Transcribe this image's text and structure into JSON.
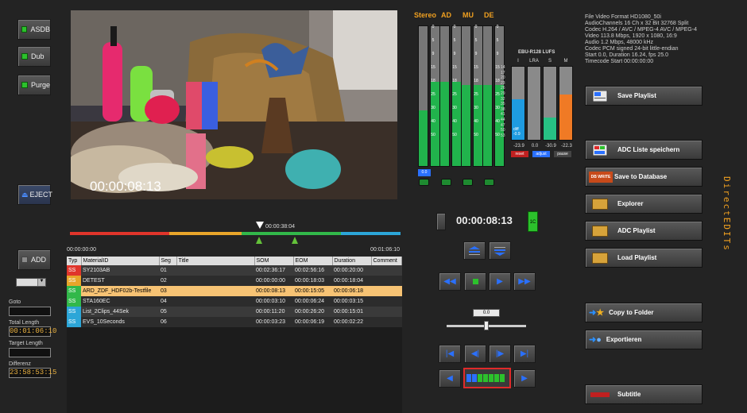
{
  "left_buttons": [
    {
      "label": "ASDB"
    },
    {
      "label": "Dub"
    },
    {
      "label": "Purge"
    }
  ],
  "eject_label": "EJECT",
  "add_label": "ADD",
  "fields": {
    "goto_label": "Goto",
    "total_length_label": "Total Length",
    "total_length_value": "00:01:06:10",
    "target_length_label": "Target Length",
    "differenz_label": "Differenz",
    "differenz_value": "23:58:53:15"
  },
  "video": {
    "timecode": "00:00:08:13"
  },
  "timeline": {
    "marker_tc": "00:00:38:04",
    "start_tc": "00:00:00:00",
    "end_tc": "00:01:06:10",
    "segments": [
      {
        "color": "#e0352b",
        "fraction": 0.3
      },
      {
        "color": "#e8a52a",
        "fraction": 0.22
      },
      {
        "color": "#32b84a",
        "fraction": 0.3
      },
      {
        "color": "#2ca6d8",
        "fraction": 0.18
      }
    ]
  },
  "table": {
    "headers": [
      "Typ",
      "MaterialID",
      "Seg",
      "Title",
      "SOM",
      "EOM",
      "Duration",
      "Comment"
    ],
    "rows": [
      {
        "typ": "SS",
        "color": "#e0352b",
        "material": "SY2103AB",
        "seg": "01",
        "title": "",
        "som": "00:02:36:17",
        "eom": "00:02:56:16",
        "dur": "00:00:20:00",
        "comment": ""
      },
      {
        "typ": "SS",
        "color": "#e8a52a",
        "material": "DETEST",
        "seg": "02",
        "title": "",
        "som": "00:00:00:00",
        "eom": "00:00:18:03",
        "dur": "00:00:18:04",
        "comment": ""
      },
      {
        "typ": "SS",
        "color": "#32b84a",
        "material": "ARD_ZDF_HDF02b-Testfile",
        "seg": "03",
        "title": "",
        "som": "00:00:08:13",
        "eom": "00:00:15:05",
        "dur": "00:00:06:18",
        "comment": ""
      },
      {
        "typ": "SS",
        "color": "#32b84a",
        "material": "STA160EC",
        "seg": "04",
        "title": "",
        "som": "00:00:03:10",
        "eom": "00:00:06:24",
        "dur": "00:00:03:15",
        "comment": ""
      },
      {
        "typ": "SS",
        "color": "#2ca6d8",
        "material": "List_2Clips_44Sek",
        "seg": "05",
        "title": "",
        "som": "00:00:11:20",
        "eom": "00:00:26:20",
        "dur": "00:00:15:01",
        "comment": ""
      },
      {
        "typ": "SS",
        "color": "#2ca6d8",
        "material": "EVS_10Seconds",
        "seg": "06",
        "title": "",
        "som": "00:00:03:23",
        "eom": "00:00:06:19",
        "dur": "00:00:02:22",
        "comment": ""
      }
    ]
  },
  "meters": {
    "labels": [
      "Stereo",
      "AD",
      "MU",
      "DE"
    ],
    "ticks": [
      "0",
      "5",
      "9",
      "15",
      "18",
      "25",
      "30",
      "40",
      "50"
    ],
    "levels": [
      0.4,
      0.6,
      0.6,
      0.6,
      0.58,
      0.58,
      0.58,
      0.58
    ],
    "stereo_readout": "0.0"
  },
  "loudness": {
    "title": "EBU-R128 LUFS",
    "col_labels": [
      "I",
      "LRA",
      "S",
      "M"
    ],
    "scale": [
      "14",
      "17",
      "20",
      "23",
      "26",
      "29",
      "32",
      "35",
      "38",
      "41",
      "44",
      "47",
      "50",
      "53"
    ],
    "values": [
      "-23.9",
      "0.0",
      "-30.9",
      "-22.3"
    ],
    "diff_label": "diff",
    "diff_value": "-0.9",
    "levels": [
      0.55,
      0.0,
      0.3,
      0.62
    ],
    "colors": [
      "#1e9be0",
      "#888888",
      "#27c183",
      "#f07a25"
    ],
    "buttons": [
      "reset",
      "adjust",
      "pause"
    ]
  },
  "transport": {
    "timecode": "00:00:08:13",
    "indicator": "1C",
    "slider_value": "0.0",
    "slider_position": 0.5
  },
  "file_info": [
    "File Video Format HD1080_50i",
    "AudioChannels 16 Ch x 32 Bit 32768 Split",
    "Codec H.264 / AVC / MPEG-4 AVC / MPEG-4",
    "Video 113.8 Mbps, 1920 x 1080, 16:9",
    "Audio 1.2 Mbps, 48000 kHz",
    "Codec PCM signed 24-bit little-endian",
    "Start 0.0, Duration 16.24, fps 25.0",
    "Timecode Start 00:00:00:00"
  ],
  "right_buttons": {
    "save_playlist": "Save Playlist",
    "adc_liste": "ADC Liste speichern",
    "save_db": "Save to Database",
    "db_write_icon": "DB WRITE",
    "explorer": "Explorer",
    "adc_playlist": "ADC Playlist",
    "load_playlist": "Load Playlist",
    "copy_folder": "Copy to Folder",
    "exportieren": "Exportieren",
    "subtitle": "Subtitle"
  },
  "brand": "DirectEDITs"
}
